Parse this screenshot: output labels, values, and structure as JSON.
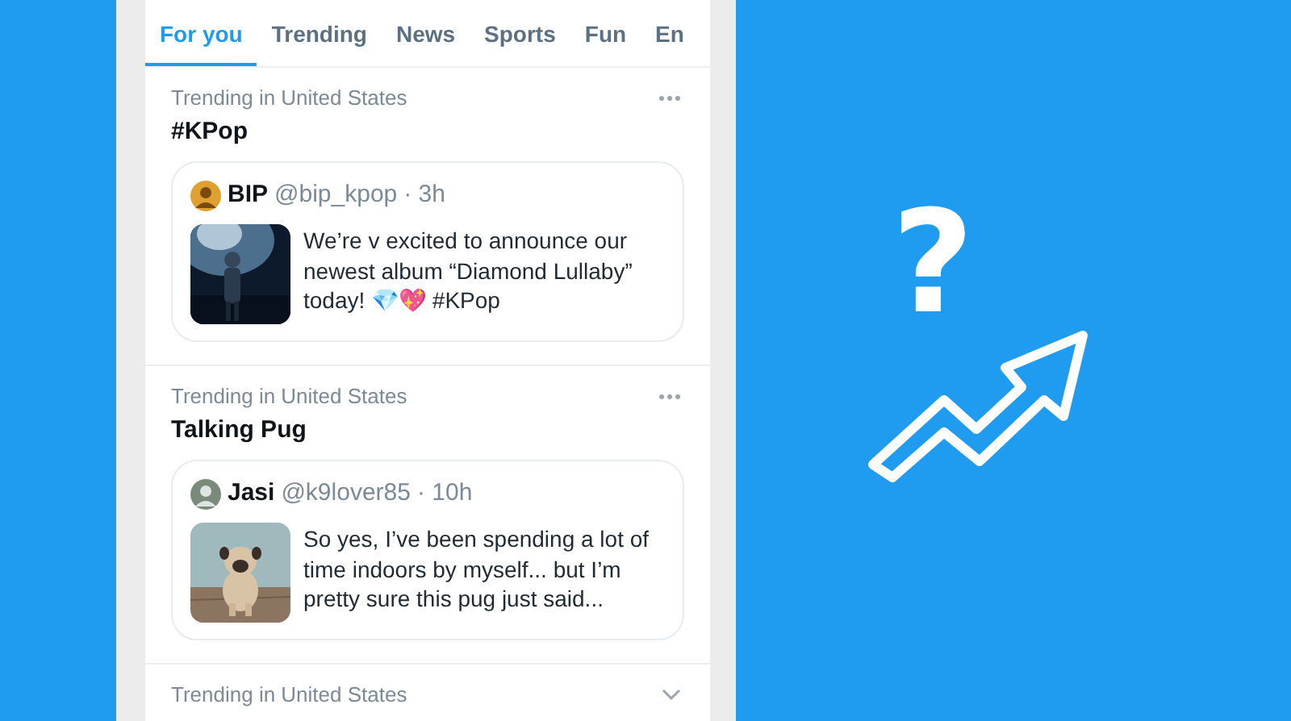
{
  "tabs": [
    {
      "label": "For you",
      "selected": true
    },
    {
      "label": "Trending",
      "selected": false
    },
    {
      "label": "News",
      "selected": false
    },
    {
      "label": "Sports",
      "selected": false
    },
    {
      "label": "Fun",
      "selected": false
    },
    {
      "label": "En",
      "selected": false
    }
  ],
  "trends": [
    {
      "context": "Trending in United States",
      "title": "#KPop",
      "kind": "full",
      "tweet": {
        "name": "BIP",
        "handle": "@bip_kpop",
        "time": "· 3h",
        "text": "We’re v excited to announce our newest album “Diamond Lullaby” today! 💎💖 #KPop",
        "kind": "concert"
      }
    },
    {
      "context": "Trending in United States",
      "title": "Talking Pug",
      "kind": "full",
      "tweet": {
        "name": "Jasi",
        "handle": "@k9lover85",
        "time": "· 10h",
        "text": "So yes, I’ve been spending a lot of time indoors by myself... but I’m pretty sure this pug just said...",
        "kind": "dog"
      }
    },
    {
      "context": "Trending in United States",
      "kind": "collapsed"
    }
  ],
  "hero": {
    "symbol": "?"
  }
}
